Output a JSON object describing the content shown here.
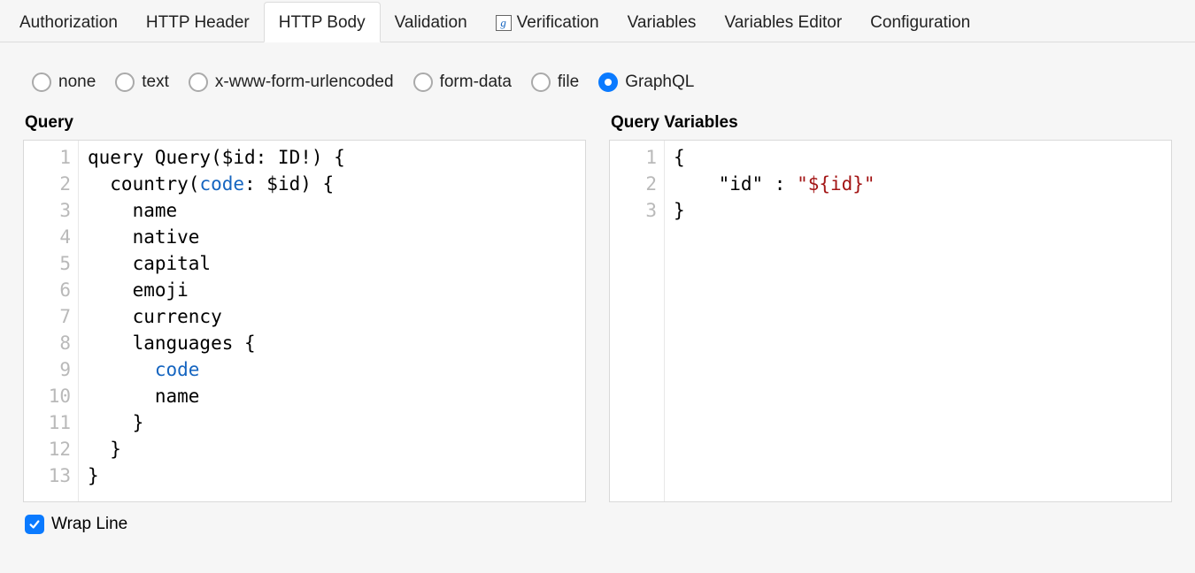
{
  "tabs": {
    "items": [
      {
        "label": "Authorization",
        "active": false,
        "icon": null
      },
      {
        "label": "HTTP Header",
        "active": false,
        "icon": null
      },
      {
        "label": "HTTP Body",
        "active": true,
        "icon": null
      },
      {
        "label": "Validation",
        "active": false,
        "icon": null
      },
      {
        "label": "Verification",
        "active": false,
        "icon": "g"
      },
      {
        "label": "Variables",
        "active": false,
        "icon": null
      },
      {
        "label": "Variables Editor",
        "active": false,
        "icon": null
      },
      {
        "label": "Configuration",
        "active": false,
        "icon": null
      }
    ]
  },
  "bodyType": {
    "options": [
      {
        "label": "none",
        "selected": false
      },
      {
        "label": "text",
        "selected": false
      },
      {
        "label": "x-www-form-urlencoded",
        "selected": false
      },
      {
        "label": "form-data",
        "selected": false
      },
      {
        "label": "file",
        "selected": false
      },
      {
        "label": "GraphQL",
        "selected": true
      }
    ]
  },
  "queryEditor": {
    "label": "Query",
    "lines": [
      {
        "n": "1",
        "segments": [
          {
            "t": "query Query($id: ID!) {",
            "c": ""
          }
        ]
      },
      {
        "n": "2",
        "segments": [
          {
            "t": "  country(",
            "c": ""
          },
          {
            "t": "code",
            "c": "kw"
          },
          {
            "t": ": $id) {",
            "c": ""
          }
        ]
      },
      {
        "n": "3",
        "segments": [
          {
            "t": "    name",
            "c": ""
          }
        ]
      },
      {
        "n": "4",
        "segments": [
          {
            "t": "    native",
            "c": ""
          }
        ]
      },
      {
        "n": "5",
        "segments": [
          {
            "t": "    capital",
            "c": ""
          }
        ]
      },
      {
        "n": "6",
        "segments": [
          {
            "t": "    emoji",
            "c": ""
          }
        ]
      },
      {
        "n": "7",
        "segments": [
          {
            "t": "    currency",
            "c": ""
          }
        ]
      },
      {
        "n": "8",
        "segments": [
          {
            "t": "    languages {",
            "c": ""
          }
        ]
      },
      {
        "n": "9",
        "segments": [
          {
            "t": "      ",
            "c": ""
          },
          {
            "t": "code",
            "c": "kw"
          }
        ]
      },
      {
        "n": "10",
        "segments": [
          {
            "t": "      name",
            "c": ""
          }
        ]
      },
      {
        "n": "11",
        "segments": [
          {
            "t": "    }",
            "c": ""
          }
        ]
      },
      {
        "n": "12",
        "segments": [
          {
            "t": "  }",
            "c": ""
          }
        ]
      },
      {
        "n": "13",
        "segments": [
          {
            "t": "}",
            "c": ""
          }
        ]
      }
    ]
  },
  "varsEditor": {
    "label": "Query Variables",
    "lines": [
      {
        "n": "1",
        "segments": [
          {
            "t": "{",
            "c": ""
          }
        ]
      },
      {
        "n": "2",
        "segments": [
          {
            "t": "    \"id\" : ",
            "c": ""
          },
          {
            "t": "\"${id}\"",
            "c": "str"
          }
        ]
      },
      {
        "n": "3",
        "segments": [
          {
            "t": "}",
            "c": ""
          }
        ]
      }
    ]
  },
  "wrapLine": {
    "label": "Wrap Line",
    "checked": true
  }
}
